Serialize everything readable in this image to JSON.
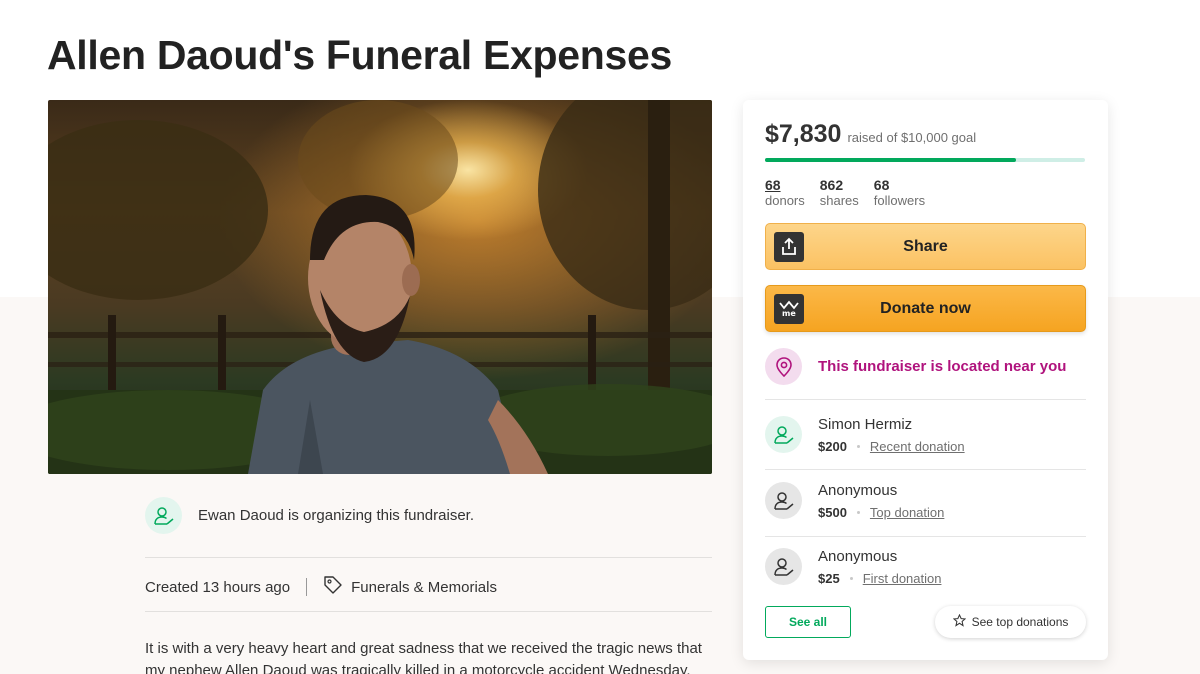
{
  "title": "Allen Daoud's Funeral Expenses",
  "hero": {
    "alt": "Photo of man at sunset",
    "icon": "photo"
  },
  "donation_card": {
    "raised_amount": "$7,830",
    "raised_goal_text": "raised of $10,000 goal",
    "progress_fraction": 0.783,
    "colors": {
      "progress": "#02a95c",
      "progress_track": "#cfeee6",
      "donate": "#f6a421",
      "share": "#fbc263",
      "near_text": "#b0137d"
    },
    "stats": [
      {
        "number": "68",
        "label": "donors"
      },
      {
        "number": "862",
        "label": "shares"
      },
      {
        "number": "68",
        "label": "followers"
      }
    ],
    "share_label": "Share",
    "donate_label": "Donate now",
    "near_text": "This fundraiser is located near you",
    "donations": [
      {
        "name": "Simon Hermiz",
        "amount": "$200",
        "kind": "Recent donation"
      },
      {
        "name": "Anonymous",
        "amount": "$500",
        "kind": "Top donation"
      },
      {
        "name": "Anonymous",
        "amount": "$25",
        "kind": "First donation"
      }
    ],
    "see_all_label": "See all",
    "see_top_label": "See top donations"
  },
  "organizer": {
    "text": "Ewan Daoud is organizing this fundraiser."
  },
  "meta": {
    "created": "Created 13 hours ago",
    "category": "Funerals & Memorials"
  },
  "story": "It is with a very heavy heart and great sadness that we received the tragic news that my nephew Allen Daoud was tragically killed in a motorcycle accident Wednesday."
}
